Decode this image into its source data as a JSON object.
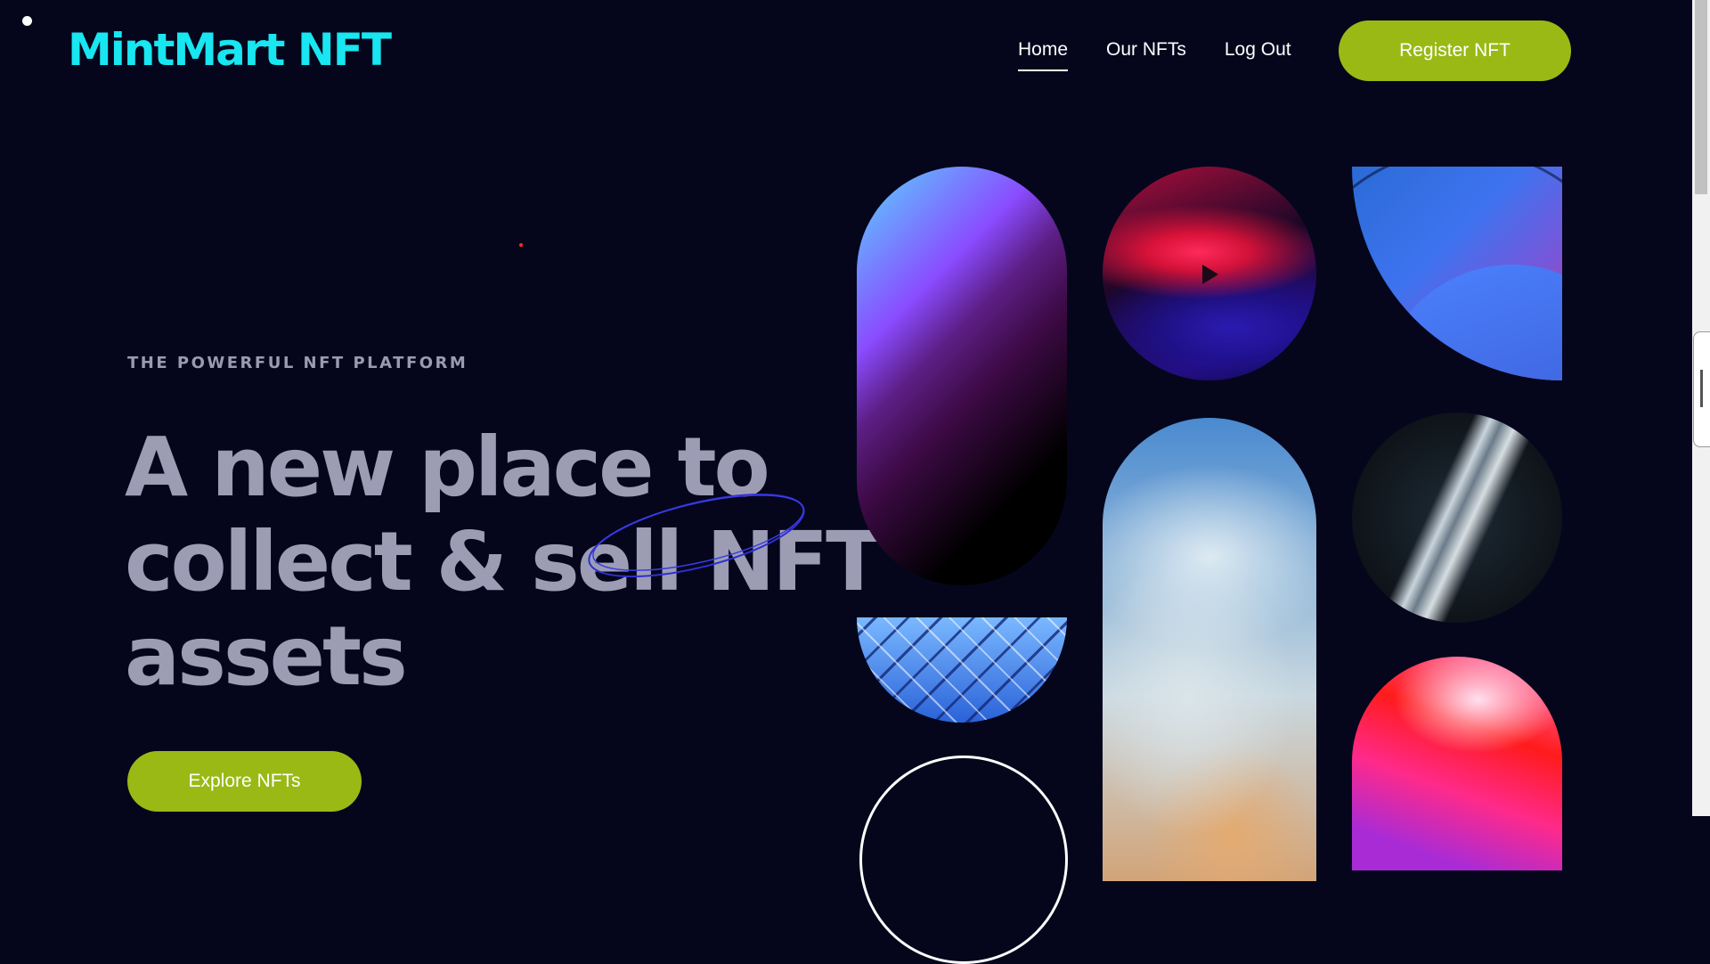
{
  "brand": {
    "logo": "MintMart NFT"
  },
  "nav": {
    "items": [
      {
        "label": "Home",
        "active": true
      },
      {
        "label": "Our NFTs",
        "active": false
      },
      {
        "label": "Log Out",
        "active": false
      }
    ],
    "register_label": "Register NFT"
  },
  "hero": {
    "eyebrow": "THE POWERFUL NFT PLATFORM",
    "headline_lines": [
      "A new place to",
      "collect & sell NFT",
      "assets"
    ],
    "cta_label": "Explore NFTs"
  },
  "colors": {
    "background": "#05061c",
    "accent_green": "#9ab915",
    "logo_cyan": "#18e6f0",
    "headline_gray": "#9c9db4"
  },
  "gallery": {
    "tiles": [
      {
        "name": "nft-purple-capsule"
      },
      {
        "name": "nft-red-space-video"
      },
      {
        "name": "nft-blue-leaf"
      },
      {
        "name": "nft-glass-roof"
      },
      {
        "name": "nft-outline-circle"
      },
      {
        "name": "nft-marble-blue"
      },
      {
        "name": "nft-silver-crack"
      },
      {
        "name": "nft-pink-gradient"
      }
    ]
  }
}
